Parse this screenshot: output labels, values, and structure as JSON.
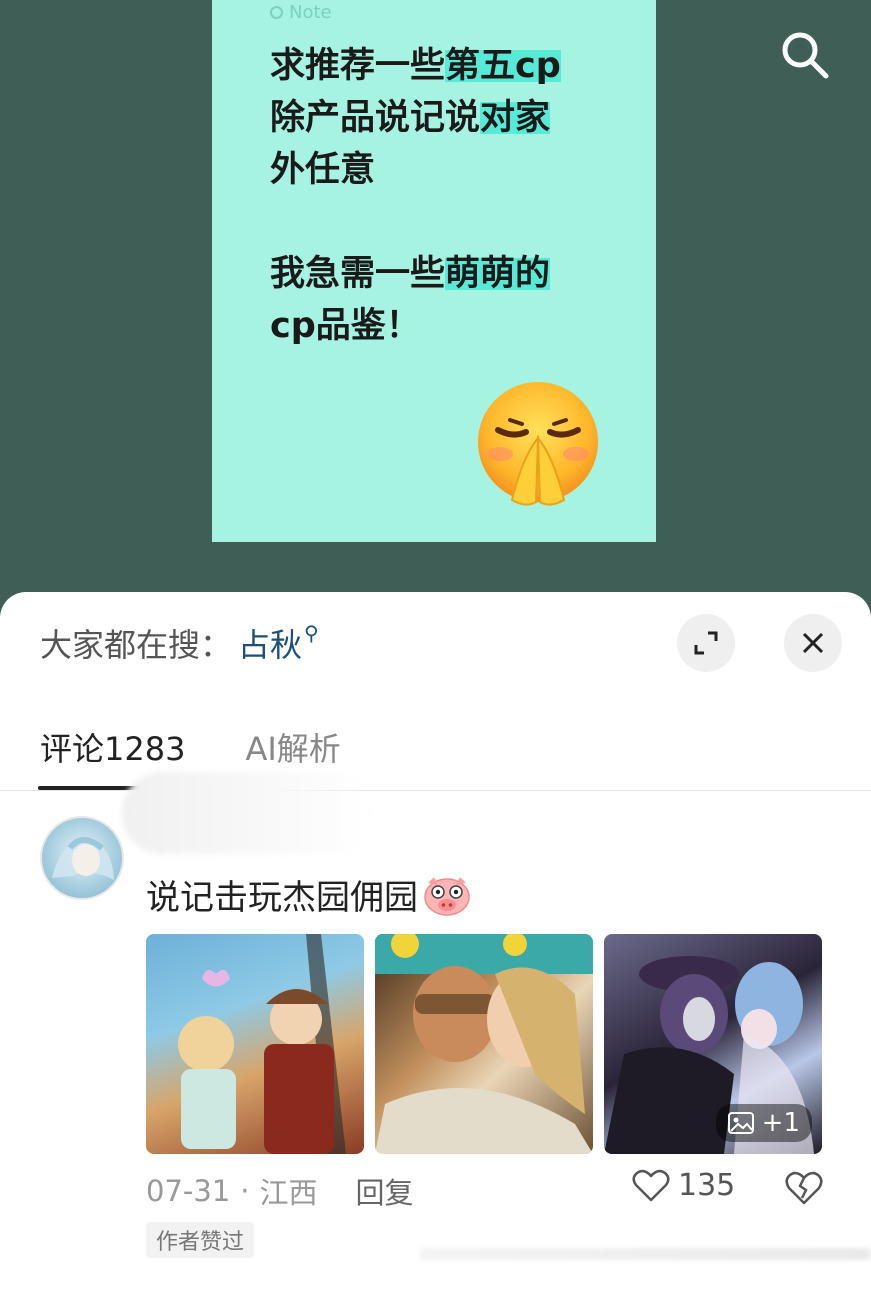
{
  "post": {
    "note_tag": "Note",
    "lines": [
      {
        "parts": [
          {
            "text": "求推荐一些",
            "hl": false
          },
          {
            "text": "第五cp",
            "hl": true
          }
        ]
      },
      {
        "parts": [
          {
            "text": "除产品说记说",
            "hl": false
          },
          {
            "text": "对家",
            "hl": true
          }
        ]
      },
      {
        "parts": [
          {
            "text": "外任意",
            "hl": false
          }
        ]
      },
      {
        "parts": [
          {
            "text": "",
            "hl": false
          }
        ]
      },
      {
        "parts": [
          {
            "text": "我急需一些",
            "hl": false
          },
          {
            "text": "萌萌的",
            "hl": true
          }
        ]
      },
      {
        "parts": [
          {
            "text": "cp品鉴！",
            "hl": false
          }
        ]
      }
    ],
    "emoji": "pleading-hands-emoji"
  },
  "header": {
    "search_icon": "search-icon"
  },
  "sheet": {
    "hot_label": "大家都在搜：",
    "hot_keyword": "占秋",
    "expand_icon": "expand-icon",
    "close_icon": "close-icon",
    "tabs": [
      {
        "label": "评论1283",
        "active": true
      },
      {
        "label": "AI解析",
        "active": false
      }
    ]
  },
  "comment": {
    "text": "说记击玩杰园佣园",
    "emoji": "pig-face-emoji",
    "images_more": "+1",
    "date": "07-31",
    "sep": "·",
    "location": "江西",
    "reply": "回复",
    "like_count": "135",
    "author_liked": "作者赞过"
  },
  "colors": {
    "background": "#3f5e55",
    "note": "#a6f3e1",
    "highlight": "#57ead6",
    "keyword": "#1d4f7a"
  }
}
